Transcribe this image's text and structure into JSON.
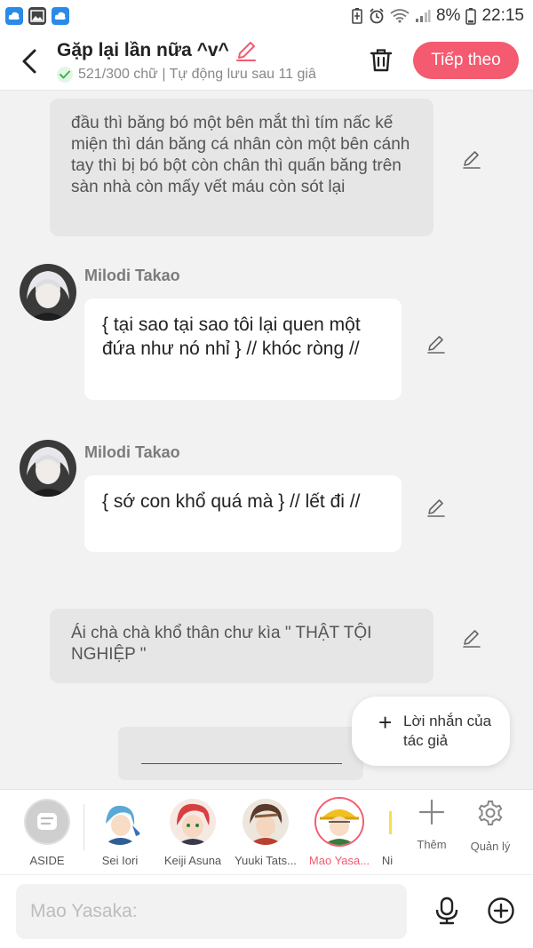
{
  "status_bar": {
    "battery": "8%",
    "time": "22:15",
    "icons": [
      "cloud-app-icon",
      "gallery-icon",
      "cloud-app-icon",
      "battery-saver-icon",
      "alarm-icon",
      "wifi-icon",
      "signal-icon",
      "battery-icon"
    ]
  },
  "header": {
    "title": "Gặp lại lần nữa ^v^",
    "meta": "521/300 chữ | Tự động lưu sau 11 giâ",
    "next_label": "Tiếp theo",
    "colors": {
      "accent": "#f45a70",
      "check": "#3bb54a"
    }
  },
  "chat": {
    "messages": [
      {
        "kind": "narration",
        "text": "đầu thì băng bó một bên mắt thì tím nấc kế miện thì dán băng cá nhân còn một bên cánh tay thì bị bó bột còn  chân thì quấn băng trên sàn nhà còn mấy vết máu còn sót lại"
      },
      {
        "kind": "dialogue",
        "sender": "Milodi Takao",
        "text": "{ tại sao tại sao tôi lại quen một đứa như nó nhỉ } // khóc ròng //"
      },
      {
        "kind": "dialogue",
        "sender": "Milodi Takao",
        "text": "{ sớ con khổ quá mà } // lết đi //"
      },
      {
        "kind": "narration",
        "text": "Ái chà chà khổ thân chư kìa \" THẬT TỘI NGHIỆP \""
      }
    ],
    "author_note": "Lời nhắn của tác giả"
  },
  "characters": {
    "aside_label": "ASIDE",
    "items": [
      {
        "name": "Sei Iori",
        "color": "#5aa9d6"
      },
      {
        "name": "Keiji Asuna",
        "color": "#d84040"
      },
      {
        "name": "Yuuki Tats...",
        "color": "#8a5a3a"
      },
      {
        "name": "Mao Yasa...",
        "color": "#f0c020",
        "active": true
      },
      {
        "name": "Ni",
        "color": "#f2e24a"
      }
    ],
    "add_label": "Thêm",
    "manage_label": "Quản lý"
  },
  "input": {
    "placeholder": "Mao Yasaka:"
  }
}
